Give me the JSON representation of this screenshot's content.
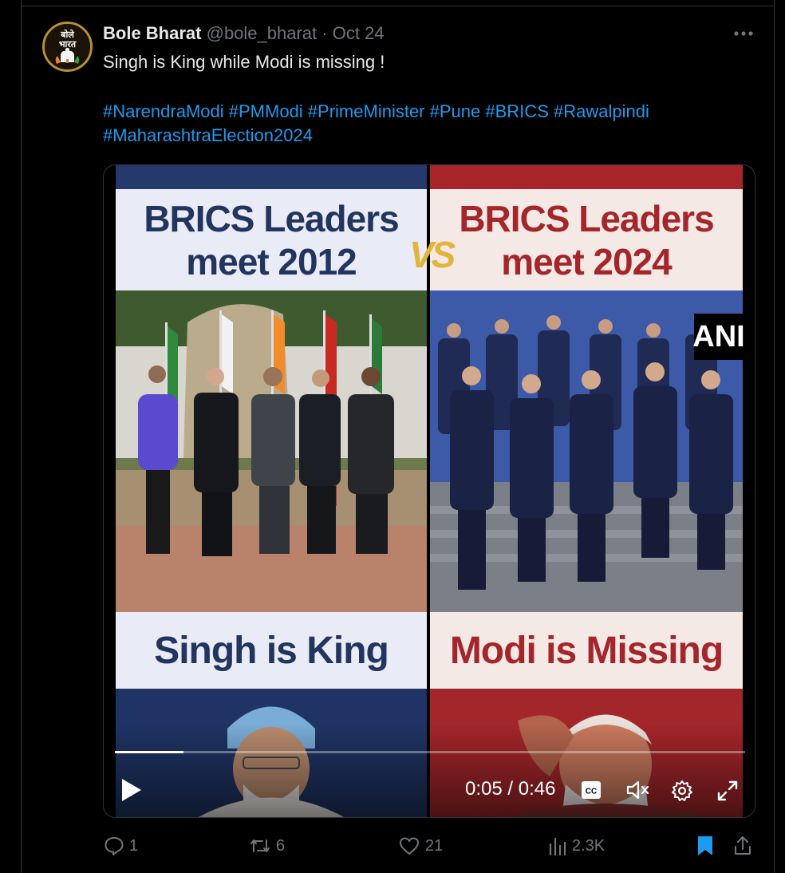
{
  "tweet": {
    "author_name": "Bole Bharat",
    "handle": "@bole_bharat",
    "separator": "·",
    "date": "Oct 24",
    "text": "Singh is King while Modi is missing !",
    "hashtags": [
      "#NarendraModi",
      "#PMModi",
      "#PrimeMinister",
      "#Pune",
      "#BRICS",
      "#Rawalpindi",
      "#MaharashtraElection2024"
    ],
    "avatar_text": [
      "बोले",
      "भारत"
    ]
  },
  "media": {
    "left_title_line1": "BRICS Leaders",
    "left_title_line2": "meet 2012",
    "right_title_line1": "BRICS Leaders",
    "right_title_line2": "meet 2024",
    "vs_label": "VS",
    "left_caption": "Singh is King",
    "right_caption": "Modi is Missing",
    "watermark": "ANI"
  },
  "video": {
    "current_time": "0:05",
    "separator": " / ",
    "duration": "0:46",
    "progress_fraction": 0.109,
    "cc_label": "CC"
  },
  "actions": {
    "reply_count": "1",
    "repost_count": "6",
    "like_count": "21",
    "views_count": "2.3K"
  },
  "icons": {
    "more": "more-icon",
    "reply": "reply-icon",
    "repost": "repost-icon",
    "like": "heart-icon",
    "views": "views-icon",
    "bookmark": "bookmark-icon",
    "share": "share-icon"
  },
  "colors": {
    "link": "#1d9bf0",
    "bookmark": "#1d9bf0",
    "muted": "#71767b",
    "left_panel": "#23355f",
    "right_panel": "#a4262a"
  }
}
